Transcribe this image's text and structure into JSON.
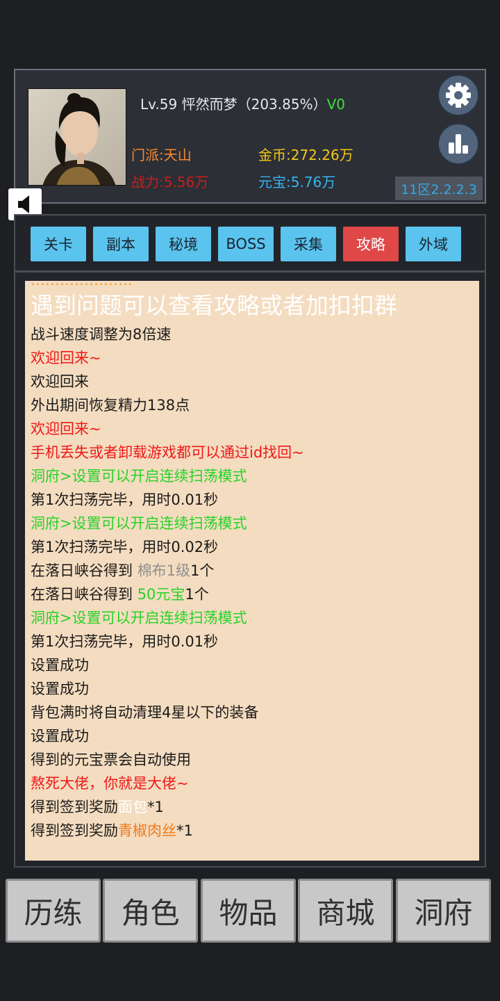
{
  "player": {
    "level_name": "Lv.59 怦然而梦（203.85%）",
    "vip": "V0",
    "sect": "门派:天山",
    "gold": "金币:272.26万",
    "power": "战力:5.56万",
    "yuanbao": "元宝:5.76万",
    "server": "11区2.2.2.3"
  },
  "icons": {
    "settings": "gear-icon",
    "rank": "bar-chart-icon",
    "sound": "speaker-icon"
  },
  "tabs": [
    {
      "label": "关卡"
    },
    {
      "label": "副本"
    },
    {
      "label": "秘境"
    },
    {
      "label": "BOSS"
    },
    {
      "label": "采集"
    },
    {
      "label": "攻略",
      "active": true
    },
    {
      "label": "外域"
    }
  ],
  "log": {
    "top_partial": "…………………",
    "big_notice": "遇到问题可以查看攻略或者加扣扣群",
    "lines": [
      {
        "text": "战斗速度调整为8倍速"
      },
      {
        "text": "欢迎回来~"
      },
      {
        "text": "欢迎回来"
      },
      {
        "text": "外出期间恢复精力138点"
      },
      {
        "text": "欢迎回来~"
      },
      {
        "text": "手机丢失或者卸载游戏都可以通过id找回~"
      },
      {
        "text": "洞府>设置可以开启连续扫荡模式"
      },
      {
        "text": "第1次扫荡完毕，用时0.01秒"
      },
      {
        "text": "洞府>设置可以开启连续扫荡模式"
      },
      {
        "text": "第1次扫荡完毕，用时0.02秒"
      },
      {
        "prefix": "在落日峡谷得到 ",
        "item": "棉布1级",
        "suffix": "1个"
      },
      {
        "prefix": "在落日峡谷得到 ",
        "item": "50元宝",
        "suffix": "1个"
      },
      {
        "text": "洞府>设置可以开启连续扫荡模式"
      },
      {
        "text": "第1次扫荡完毕，用时0.01秒"
      },
      {
        "text": "设置成功"
      },
      {
        "text": "设置成功"
      },
      {
        "text": "背包满时将自动清理4星以下的装备"
      },
      {
        "text": "设置成功"
      },
      {
        "text": "得到的元宝票会自动使用"
      },
      {
        "text": "熬死大佬，你就是大佬~"
      },
      {
        "prefix": "得到签到奖励",
        "item": "面包",
        "suffix": "*1"
      },
      {
        "prefix": "得到签到奖励",
        "item": "青椒肉丝",
        "suffix": "*1"
      }
    ]
  },
  "nav": [
    {
      "label": "历练"
    },
    {
      "label": "角色"
    },
    {
      "label": "物品"
    },
    {
      "label": "商城"
    },
    {
      "label": "洞府"
    }
  ]
}
